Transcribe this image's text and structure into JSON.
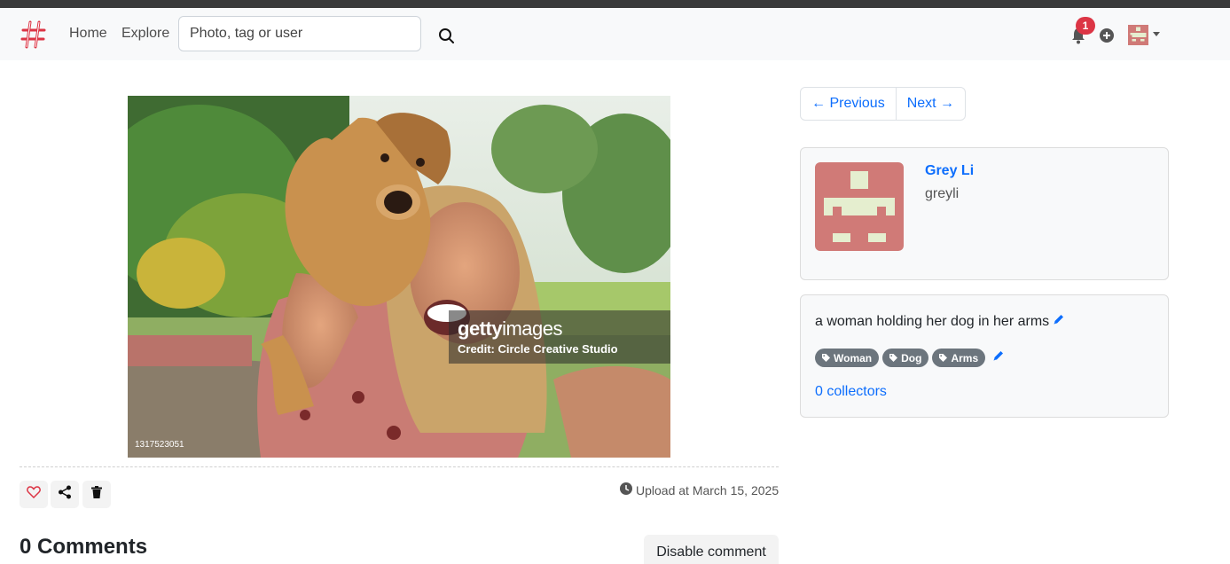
{
  "navbar": {
    "brand_icon": "hashtag-logo-icon",
    "home_label": "Home",
    "explore_label": "Explore",
    "search_placeholder": "Photo, tag or user",
    "notification_count": "1",
    "colors": {
      "brand": "#dc3545",
      "badge": "#dc3545",
      "link": "#0d6efd"
    }
  },
  "photo": {
    "watermark_logo_bold": "getty",
    "watermark_logo_light": "images",
    "watermark_credit": "Credit: Circle Creative Studio",
    "image_id": "1317523051"
  },
  "actions": {
    "like_icon": "heart-icon",
    "share_icon": "share-icon",
    "delete_icon": "trash-icon",
    "upload_text": "Upload at March 15, 2025"
  },
  "comments": {
    "title": "0 Comments",
    "disable_label": "Disable comment"
  },
  "pager": {
    "previous_label": "← Previous",
    "next_label": "Next →"
  },
  "profile": {
    "name": "Grey Li",
    "username": "greyli",
    "avatar_colors": {
      "background": "#d07a77",
      "pattern": "#e5eecf"
    }
  },
  "description": {
    "text": "a woman holding her dog in her arms",
    "tags": [
      "Woman",
      "Dog",
      "Arms"
    ],
    "collectors": "0 collectors"
  }
}
